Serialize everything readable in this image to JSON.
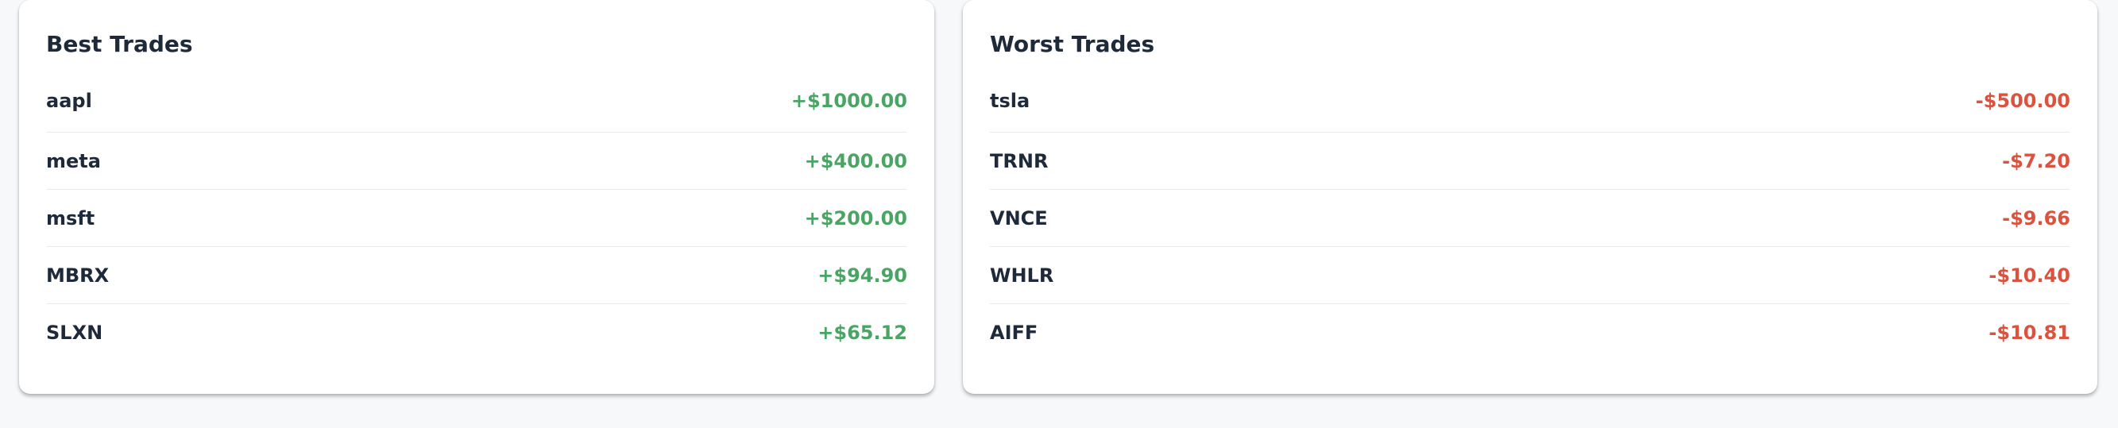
{
  "best": {
    "title": "Best Trades",
    "rows": [
      {
        "symbol": "aapl",
        "amount": "+$1000.00"
      },
      {
        "symbol": "meta",
        "amount": "+$400.00"
      },
      {
        "symbol": "msft",
        "amount": "+$200.00"
      },
      {
        "symbol": "MBRX",
        "amount": "+$94.90"
      },
      {
        "symbol": "SLXN",
        "amount": "+$65.12"
      }
    ]
  },
  "worst": {
    "title": "Worst Trades",
    "rows": [
      {
        "symbol": "tsla",
        "amount": "-$500.00"
      },
      {
        "symbol": "TRNR",
        "amount": "-$7.20"
      },
      {
        "symbol": "VNCE",
        "amount": "-$9.66"
      },
      {
        "symbol": "WHLR",
        "amount": "-$10.40"
      },
      {
        "symbol": "AIFF",
        "amount": "-$10.81"
      }
    ]
  },
  "colors": {
    "positive": "#4aa564",
    "negative": "#d9533e",
    "text": "#1e2a3a"
  }
}
